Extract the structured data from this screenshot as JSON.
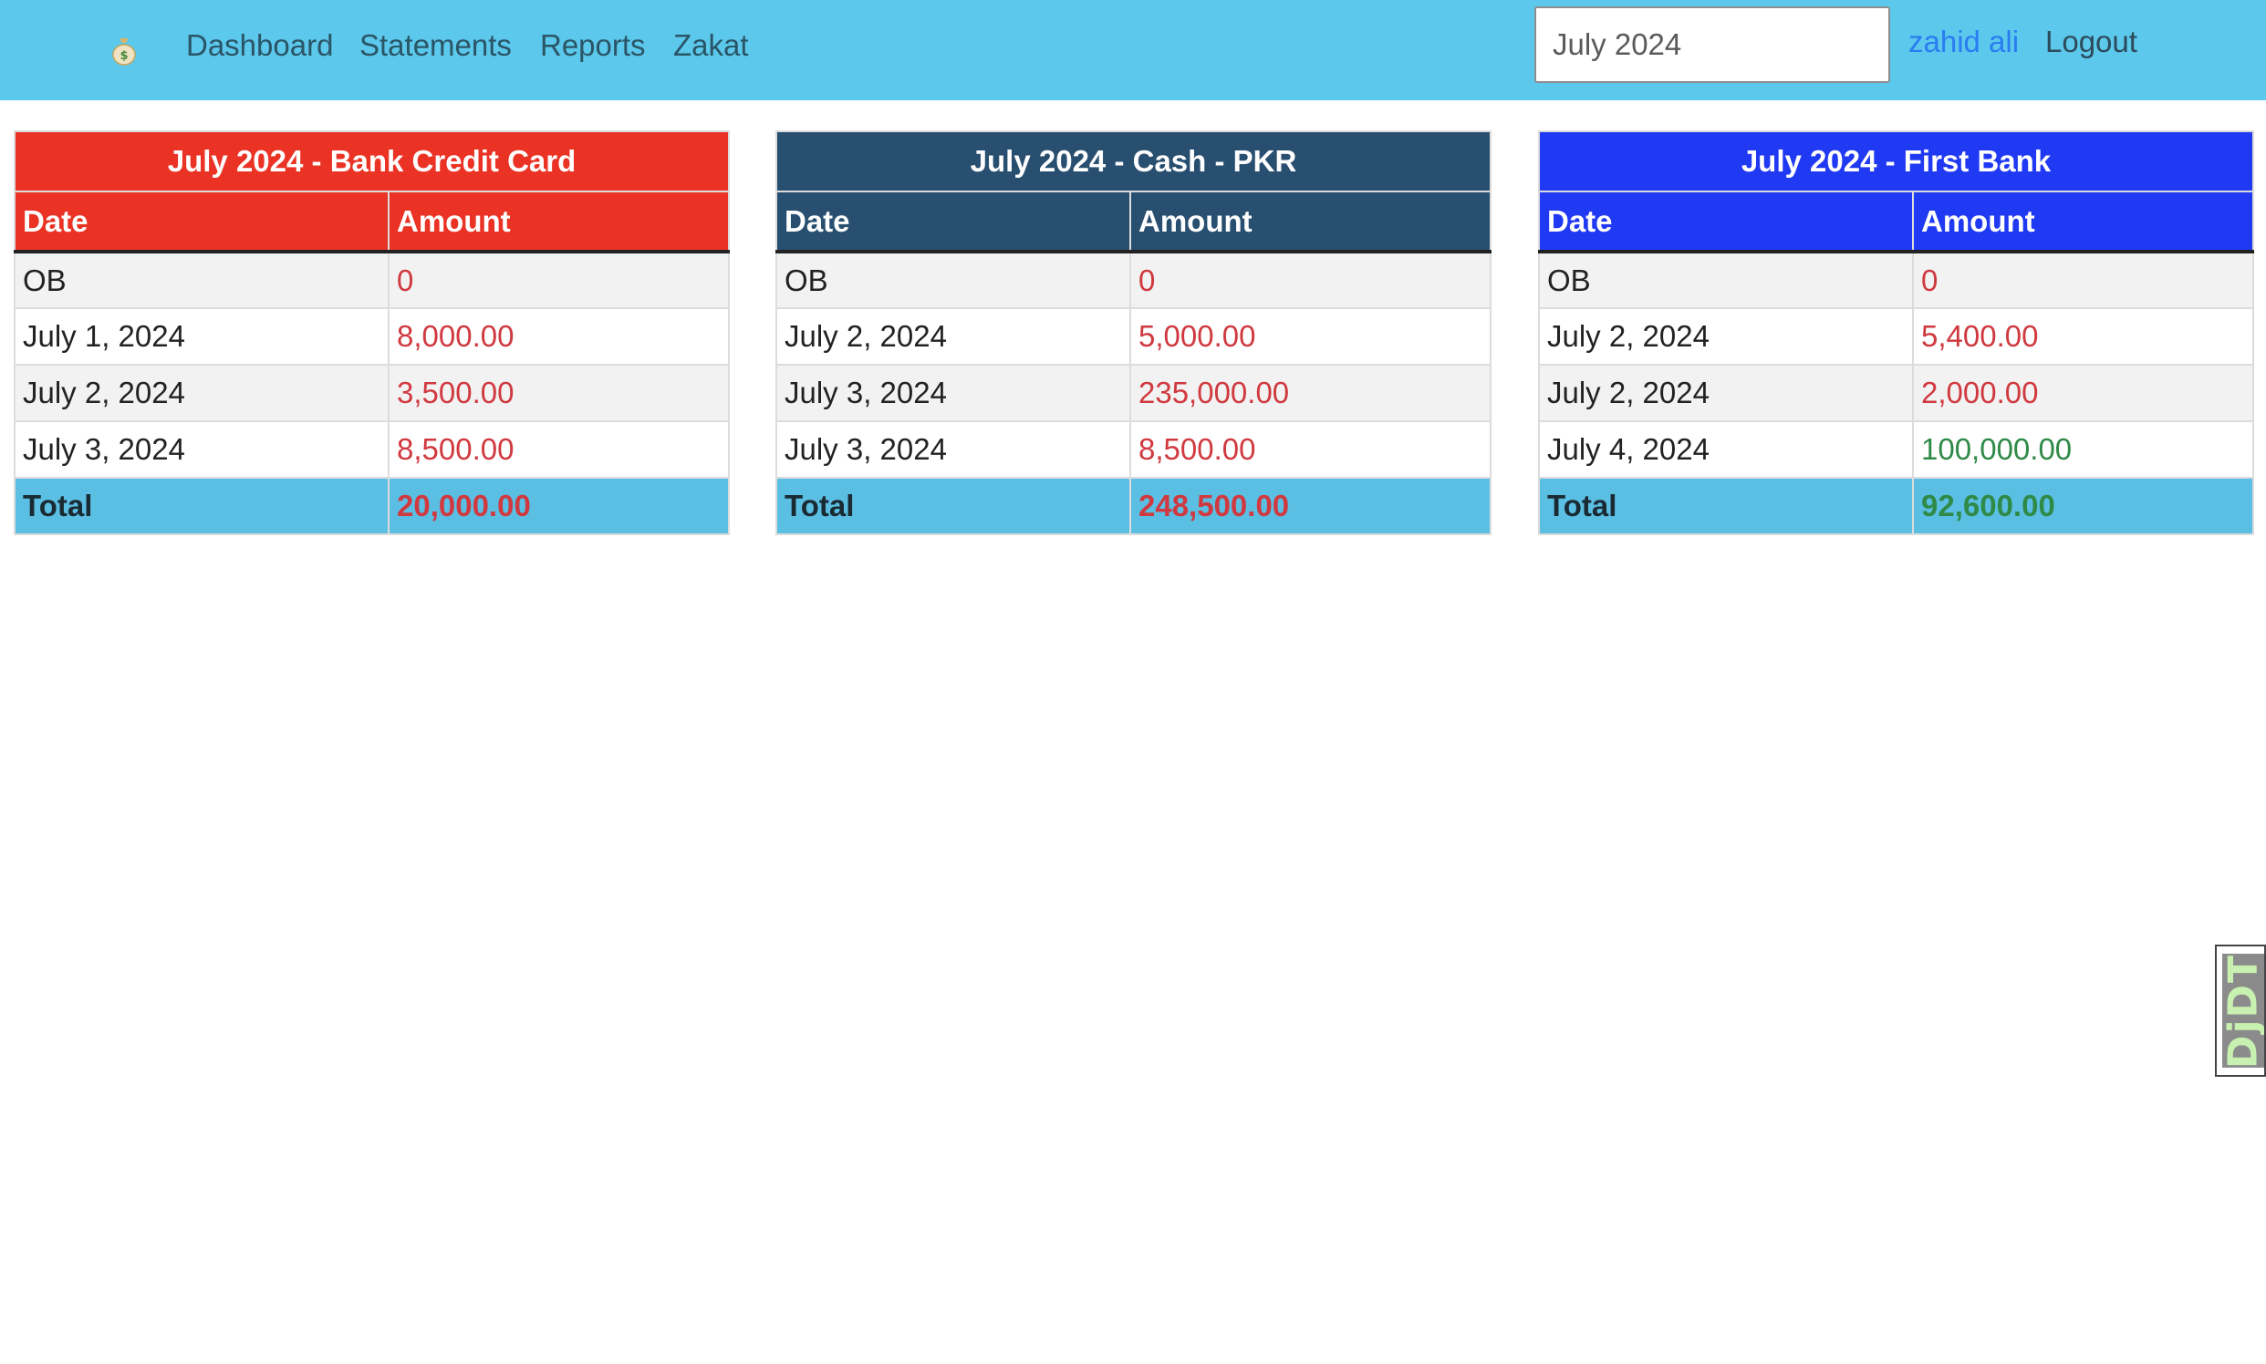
{
  "navbar": {
    "brand_icon": "money-bag-icon",
    "links": [
      "Dashboard",
      "Statements",
      "Reports",
      "Zakat"
    ],
    "month_value": "July 2024",
    "user": "zahid ali",
    "logout": "Logout",
    "color": "#5bc8ec"
  },
  "tables": [
    {
      "title": "July 2024 - Bank Credit Card",
      "color": "#ea3324",
      "col_date": "Date",
      "col_amount": "Amount",
      "rows": [
        {
          "date": "OB",
          "amount": "0"
        },
        {
          "date": "July 1, 2024",
          "amount": "8,000.00"
        },
        {
          "date": "July 2, 2024",
          "amount": "3,500.00"
        },
        {
          "date": "July 3, 2024",
          "amount": "8,500.00"
        }
      ],
      "total_label": "Total",
      "total": "20,000.00"
    },
    {
      "title": "July 2024 - Cash - PKR",
      "color": "#284f70",
      "col_date": "Date",
      "col_amount": "Amount",
      "rows": [
        {
          "date": "OB",
          "amount": "0"
        },
        {
          "date": "July 2, 2024",
          "amount": "5,000.00"
        },
        {
          "date": "July 3, 2024",
          "amount": "235,000.00"
        },
        {
          "date": "July 3, 2024",
          "amount": "8,500.00"
        }
      ],
      "total_label": "Total",
      "total": "248,500.00"
    },
    {
      "title": "July 2024 - First Bank",
      "color": "#2039f2",
      "col_date": "Date",
      "col_amount": "Amount",
      "rows": [
        {
          "date": "OB",
          "amount": "0"
        },
        {
          "date": "July 2, 2024",
          "amount": "5,400.00"
        },
        {
          "date": "July 2, 2024",
          "amount": "2,000.00"
        },
        {
          "date": "July 4, 2024",
          "amount": "100,000.00"
        }
      ],
      "total_label": "Total",
      "total": "92,600.00"
    }
  ],
  "side_widget": {
    "label": "DjDT"
  }
}
